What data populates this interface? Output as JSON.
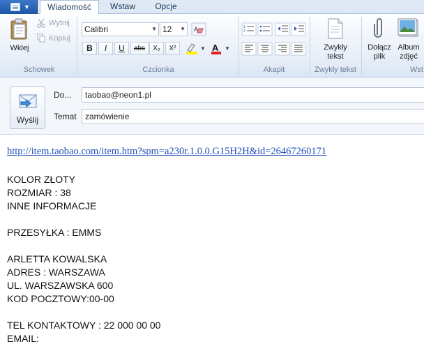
{
  "tabs": {
    "active": "Wiadomość",
    "items": [
      "Wiadomość",
      "Wstaw",
      "Opcje"
    ]
  },
  "ribbon": {
    "clipboard": {
      "paste_label": "Wklej",
      "cut_label": "Wytnij",
      "copy_label": "Kopiuj",
      "group_label": "Schowek"
    },
    "font": {
      "family": "Calibri",
      "size": "12",
      "group_label": "Czcionka",
      "buttons": [
        "B",
        "I",
        "U",
        "abc",
        "X₂",
        "X²"
      ]
    },
    "paragraph": {
      "group_label": "Akapit"
    },
    "plain_text": {
      "label": "Zwykły tekst",
      "group_label": "Zwykły tekst"
    },
    "insert": {
      "attach_label": "Dołącz plik",
      "album_label": "Album zdjęć",
      "group_partial": "Wst"
    }
  },
  "header": {
    "send_label": "Wyślij",
    "to_label": "Do...",
    "to_value": "taobao@neon1.pl",
    "subject_label": "Temat",
    "subject_value": "zamówienie"
  },
  "body": {
    "link": "http://item.taobao.com/item.htm?spm=a230r.1.0.0.G15H2H&id=26467260171",
    "lines": [
      "KOLOR ZŁOTY",
      "ROZMIAR : 38",
      "INNE INFORMACJE",
      "PRZESYŁKA : EMMS",
      "ARLETTA KOWALSKA",
      "ADRES : WARSZAWA",
      "UL. WARSZAWSKA 600",
      "KOD POCZTOWY:00-00",
      "TEL KONTAKTOWY :  22 000 00 00",
      "EMAIL:"
    ]
  },
  "colors": {
    "ribbon_bg": "#e7eef8",
    "tab_bar": "#dfe9f5",
    "app_button": "#2a66b8",
    "link": "#1f4fb5"
  }
}
